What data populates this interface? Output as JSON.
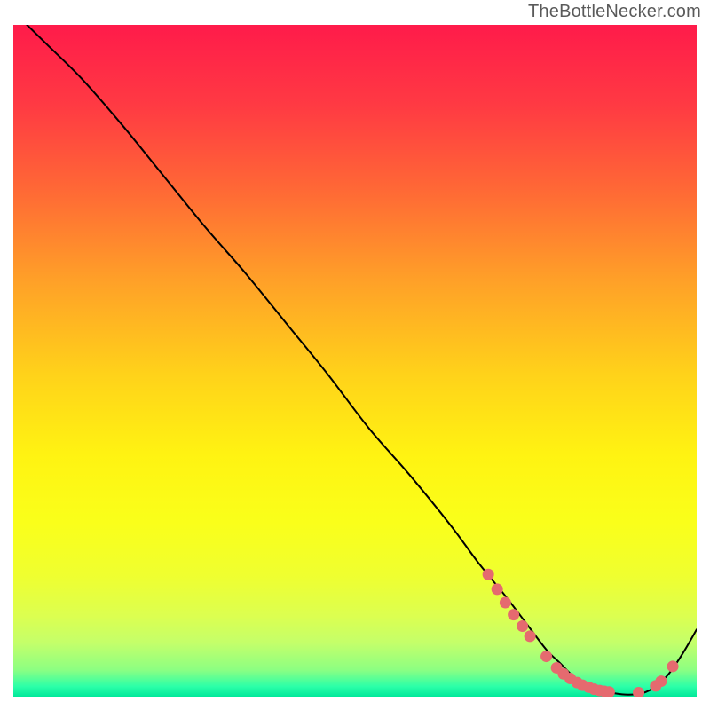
{
  "attribution": "TheBottleNecker.com",
  "chart_data": {
    "type": "line",
    "title": "",
    "xlabel": "",
    "ylabel": "",
    "xlim": [
      0,
      100
    ],
    "ylim": [
      0,
      100
    ],
    "series": [
      {
        "name": "bottleneck-curve",
        "x": [
          2,
          5,
          10,
          16,
          22,
          28,
          34,
          40,
          46,
          52,
          58,
          64,
          68,
          72,
          75,
          78,
          80,
          82,
          84,
          86,
          88,
          90,
          92,
          94,
          96,
          98,
          100
        ],
        "y": [
          100,
          97,
          92,
          85,
          77.5,
          70,
          63,
          55.5,
          48,
          40,
          33,
          25.5,
          20,
          15,
          11,
          7,
          5,
          3,
          1.8,
          1,
          0.5,
          0.3,
          0.5,
          1.5,
          3.5,
          6.5,
          10
        ]
      }
    ],
    "markers": {
      "name": "highlighted-points",
      "color": "#e56a6f",
      "points": [
        {
          "x": 69.5,
          "y": 18.2
        },
        {
          "x": 70.8,
          "y": 16.0
        },
        {
          "x": 72.0,
          "y": 14.0
        },
        {
          "x": 73.2,
          "y": 12.2
        },
        {
          "x": 74.5,
          "y": 10.5
        },
        {
          "x": 75.6,
          "y": 9.0
        },
        {
          "x": 78.0,
          "y": 6.0
        },
        {
          "x": 79.5,
          "y": 4.3
        },
        {
          "x": 80.5,
          "y": 3.4
        },
        {
          "x": 81.5,
          "y": 2.7
        },
        {
          "x": 82.5,
          "y": 2.1
        },
        {
          "x": 83.3,
          "y": 1.7
        },
        {
          "x": 84.2,
          "y": 1.4
        },
        {
          "x": 85.0,
          "y": 1.1
        },
        {
          "x": 85.8,
          "y": 0.9
        },
        {
          "x": 86.5,
          "y": 0.8
        },
        {
          "x": 87.2,
          "y": 0.7
        },
        {
          "x": 91.5,
          "y": 0.6
        },
        {
          "x": 94.0,
          "y": 1.6
        },
        {
          "x": 94.8,
          "y": 2.3
        },
        {
          "x": 96.5,
          "y": 4.5
        }
      ]
    },
    "background_gradient": {
      "stops": [
        {
          "offset": 0.0,
          "color": "#ff1b4a"
        },
        {
          "offset": 0.12,
          "color": "#ff3a43"
        },
        {
          "offset": 0.25,
          "color": "#ff6a35"
        },
        {
          "offset": 0.38,
          "color": "#ffa028"
        },
        {
          "offset": 0.52,
          "color": "#ffd21a"
        },
        {
          "offset": 0.64,
          "color": "#fff312"
        },
        {
          "offset": 0.74,
          "color": "#faff1a"
        },
        {
          "offset": 0.82,
          "color": "#efff30"
        },
        {
          "offset": 0.88,
          "color": "#dcff50"
        },
        {
          "offset": 0.92,
          "color": "#c4ff6a"
        },
        {
          "offset": 0.96,
          "color": "#8cff82"
        },
        {
          "offset": 0.985,
          "color": "#2bffa8"
        },
        {
          "offset": 1.0,
          "color": "#00e89a"
        }
      ]
    }
  }
}
